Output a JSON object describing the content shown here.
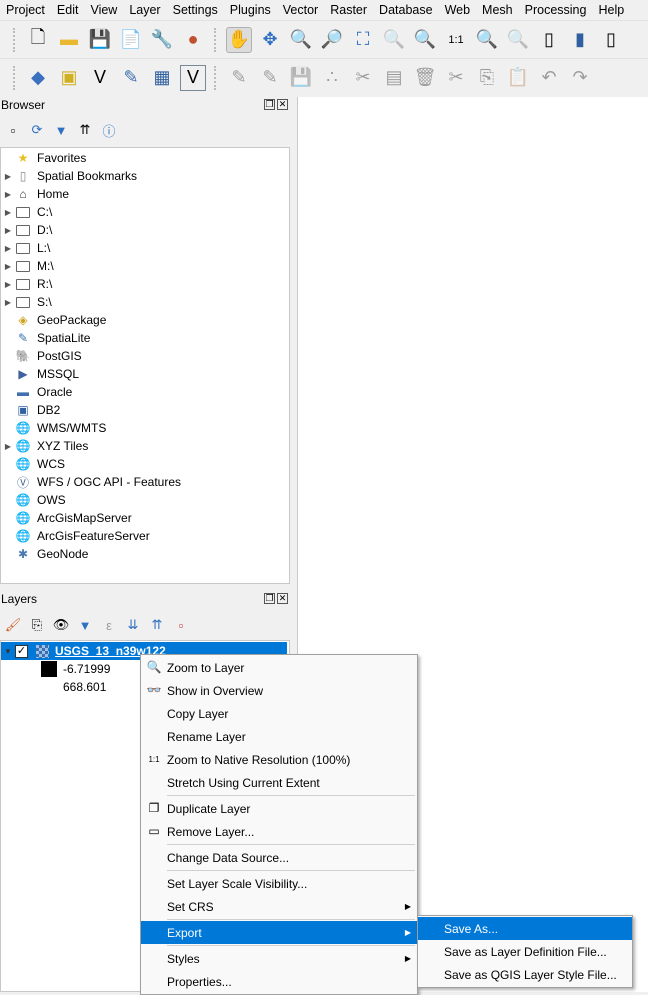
{
  "menubar": [
    "Project",
    "Edit",
    "View",
    "Layer",
    "Settings",
    "Plugins",
    "Vector",
    "Raster",
    "Database",
    "Web",
    "Mesh",
    "Processing",
    "Help"
  ],
  "browser": {
    "title": "Browser",
    "items": [
      {
        "label": "Favorites",
        "icon": "star-icon",
        "expand": false
      },
      {
        "label": "Spatial Bookmarks",
        "icon": "bookmark-icon",
        "expand": true
      },
      {
        "label": "Home",
        "icon": "home-icon",
        "expand": true
      },
      {
        "label": "C:\\",
        "icon": "folder-icon",
        "expand": true
      },
      {
        "label": "D:\\",
        "icon": "folder-icon",
        "expand": true
      },
      {
        "label": "L:\\",
        "icon": "folder-icon",
        "expand": true
      },
      {
        "label": "M:\\",
        "icon": "folder-icon",
        "expand": true
      },
      {
        "label": "R:\\",
        "icon": "folder-icon",
        "expand": true
      },
      {
        "label": "S:\\",
        "icon": "folder-icon",
        "expand": true
      },
      {
        "label": "GeoPackage",
        "icon": "geopackage-icon",
        "expand": false
      },
      {
        "label": "SpatiaLite",
        "icon": "spatialite-icon",
        "expand": false
      },
      {
        "label": "PostGIS",
        "icon": "postgis-icon",
        "expand": false
      },
      {
        "label": "MSSQL",
        "icon": "mssql-icon",
        "expand": false
      },
      {
        "label": "Oracle",
        "icon": "oracle-icon",
        "expand": false
      },
      {
        "label": "DB2",
        "icon": "db2-icon",
        "expand": false
      },
      {
        "label": "WMS/WMTS",
        "icon": "globe-icon",
        "expand": false
      },
      {
        "label": "XYZ Tiles",
        "icon": "globe-icon",
        "expand": true
      },
      {
        "label": "WCS",
        "icon": "globe-icon",
        "expand": false
      },
      {
        "label": "WFS / OGC API - Features",
        "icon": "wfs-icon",
        "expand": false
      },
      {
        "label": "OWS",
        "icon": "globe-icon",
        "expand": false
      },
      {
        "label": "ArcGisMapServer",
        "icon": "globe-icon",
        "expand": false
      },
      {
        "label": "ArcGisFeatureServer",
        "icon": "globe-icon",
        "expand": false
      },
      {
        "label": "GeoNode",
        "icon": "geonode-icon",
        "expand": false
      }
    ]
  },
  "layers": {
    "title": "Layers",
    "layer_name": "USGS_13_n39w122",
    "checked": true,
    "legend": [
      "-6.71999",
      "668.601"
    ]
  },
  "context_menu": [
    {
      "label": "Zoom to Layer",
      "icon": "zoom-icon"
    },
    {
      "label": "Show in Overview",
      "icon": "overview-icon"
    },
    {
      "label": "Copy Layer"
    },
    {
      "label": "Rename Layer"
    },
    {
      "label": "Zoom to Native Resolution (100%)",
      "icon": "native-res-icon"
    },
    {
      "label": "Stretch Using Current Extent"
    },
    {
      "sep": true
    },
    {
      "label": "Duplicate Layer",
      "icon": "duplicate-icon"
    },
    {
      "label": "Remove Layer...",
      "icon": "remove-icon"
    },
    {
      "sep": true
    },
    {
      "label": "Change Data Source..."
    },
    {
      "sep": true
    },
    {
      "label": "Set Layer Scale Visibility..."
    },
    {
      "label": "Set CRS",
      "submenu": true
    },
    {
      "sep": true
    },
    {
      "label": "Export",
      "submenu": true,
      "highlighted": true
    },
    {
      "sep": true
    },
    {
      "label": "Styles",
      "submenu": true
    },
    {
      "label": "Properties..."
    }
  ],
  "export_submenu": [
    "Save As...",
    "Save as Layer Definition File...",
    "Save as QGIS Layer Style File..."
  ],
  "colors": {
    "highlight": "#0078d7"
  }
}
